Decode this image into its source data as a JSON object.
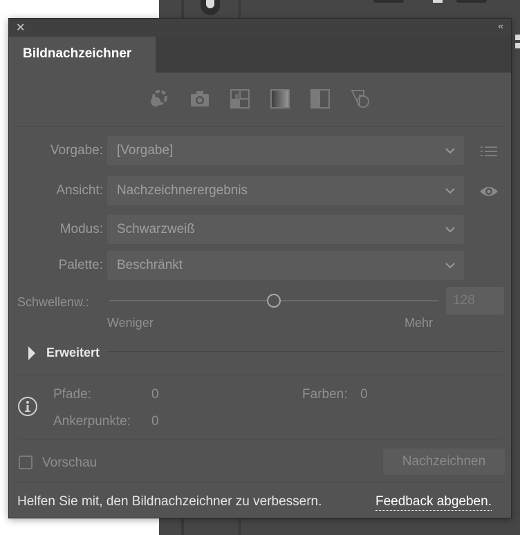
{
  "panel": {
    "tab_title": "Bildnachzeichner",
    "close_glyph": "✕",
    "collapse_glyph": "‹‹",
    "preset_icons": [
      "auto-color-icon",
      "photo-camera-icon",
      "low-color-icon",
      "grayscale-icon",
      "black-white-icon",
      "outline-icon"
    ]
  },
  "fields": {
    "preset": {
      "label": "Vorgabe:",
      "value": "[Vorgabe]"
    },
    "view": {
      "label": "Ansicht:",
      "value": "Nachzeichnerergebnis"
    },
    "mode": {
      "label": "Modus:",
      "value": "Schwarzweiß"
    },
    "palette": {
      "label": "Palette:",
      "value": "Beschränkt"
    }
  },
  "threshold": {
    "label": "Schwellenw.:",
    "value": "128",
    "fraction": 0.5,
    "min_label": "Weniger",
    "max_label": "Mehr"
  },
  "advanced": {
    "label": "Erweitert"
  },
  "stats": {
    "paths_label": "Pfade:",
    "paths_value": "0",
    "colors_label": "Farben:",
    "colors_value": "0",
    "anchors_label": "Ankerpunkte:",
    "anchors_value": "0"
  },
  "preview": {
    "label": "Vorschau",
    "checked": false
  },
  "trace_button": {
    "label": "Nachzeichnen"
  },
  "footer": {
    "text": "Helfen Sie mit, den Bildnachzeichner zu verbessern.",
    "link": "Feedback abgeben."
  }
}
